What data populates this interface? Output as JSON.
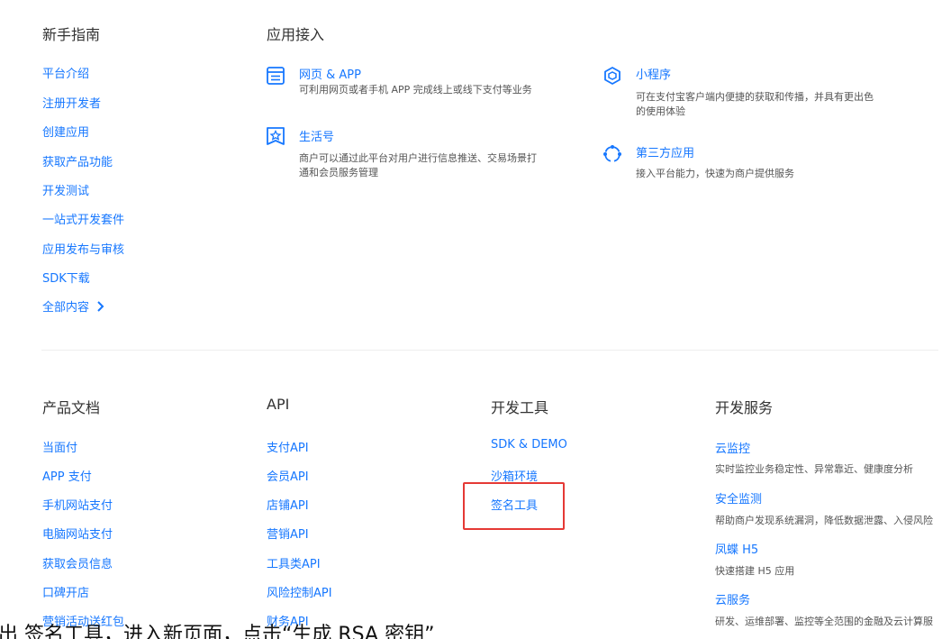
{
  "guide": {
    "heading": "新手指南",
    "links": [
      "平台介绍",
      "注册开发者",
      "创建应用",
      "获取产品功能",
      "开发测试",
      "一站式开发套件",
      "应用发布与审核",
      "SDK下载"
    ],
    "all": "全部内容"
  },
  "access": {
    "heading": "应用接入",
    "cards": [
      {
        "title": "网页 & APP",
        "desc": [
          "可利用网页或者手机 APP 完成线上或线下支付等业务"
        ]
      },
      {
        "title": "生活号",
        "desc": [
          "商户可以通过此平台对用户进行信息推送、交易场景打",
          "通和会员服务管理"
        ]
      },
      {
        "title": "小程序",
        "desc": [
          "可在支付宝客户端内便捷的获取和传播，并具有更出色",
          "的使用体验"
        ]
      },
      {
        "title": "第三方应用",
        "desc": [
          "接入平台能力，快速为商户提供服务"
        ]
      }
    ]
  },
  "docs": {
    "heading": "产品文档",
    "links": [
      "当面付",
      "APP 支付",
      "手机网站支付",
      "电脑网站支付",
      "获取会员信息",
      "口碑开店",
      "营销活动送红包"
    ]
  },
  "api": {
    "heading": "API",
    "links": [
      "支付API",
      "会员API",
      "店铺API",
      "营销API",
      "工具类API",
      "风险控制API",
      "财务API"
    ]
  },
  "tools": {
    "heading": "开发工具",
    "links": [
      "SDK & DEMO",
      "沙箱环境",
      "签名工具"
    ]
  },
  "services": {
    "heading": "开发服务",
    "items": [
      {
        "title": "云监控",
        "desc": "实时监控业务稳定性、异常靠近、健康度分析"
      },
      {
        "title": "安全监测",
        "desc": "帮助商户发现系统漏洞，降低数据泄露、入侵风险"
      },
      {
        "title": "凤蝶 H5",
        "desc": "快速搭建 H5 应用"
      },
      {
        "title": "云服务",
        "desc": "研发、运维部署、监控等全范围的金融及云计算服"
      }
    ]
  },
  "caption": "出  签名工具，进入新页面，点击“生成 RSA 密钥”"
}
